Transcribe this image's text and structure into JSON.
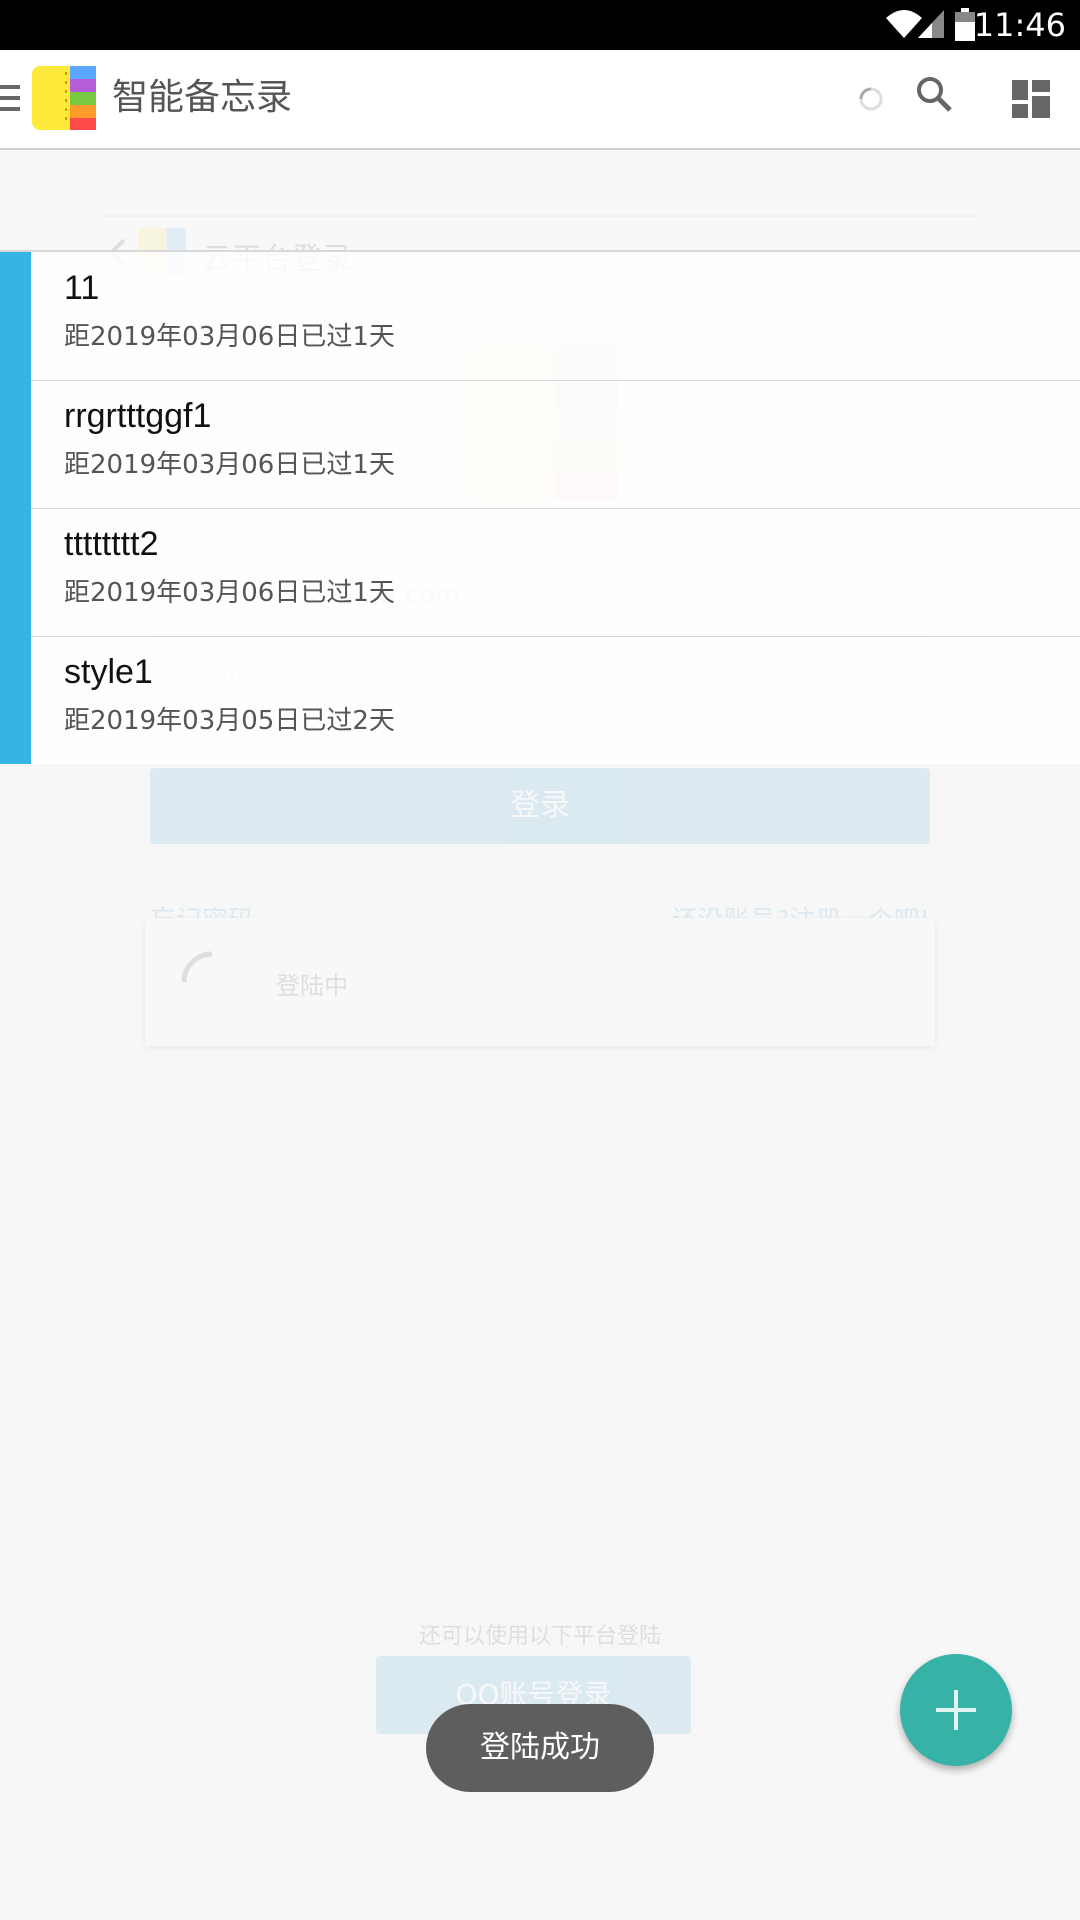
{
  "status_bar": {
    "time": "11:46",
    "icons": [
      "wifi-icon",
      "cell-signal-icon",
      "battery-icon"
    ]
  },
  "app_bar": {
    "title": "智能备忘录",
    "icons": [
      "menu-icon",
      "app-logo",
      "loading-spinner-icon",
      "search-icon",
      "dashboard-icon"
    ]
  },
  "notes": [
    {
      "name": "11",
      "subtitle": "距2019年03月06日已过1天"
    },
    {
      "name": "rrgrtttggf1",
      "subtitle": "距2019年03月06日已过1天"
    },
    {
      "name": "tttttttt2",
      "subtitle": "距2019年03月06日已过1天"
    },
    {
      "name": "style1",
      "subtitle": "距2019年03月05日已过2天"
    }
  ],
  "background_login": {
    "header_title": "云平台登录",
    "account_hint": "q.com",
    "password_mask": "·········",
    "login_button": "登录",
    "forgot_password": "忘记密码",
    "register_prompt": "还没账号?注册一个吧!",
    "loading_text": "登陆中",
    "other_platforms_note": "还可以使用以下平台登陆",
    "qq_login_button": "QQ账号登录"
  },
  "toast": {
    "message": "登陆成功"
  },
  "fab": {
    "icon": "plus-icon"
  },
  "colors": {
    "accent_bar": "#35b5e5",
    "fab": "#36b3a6",
    "toast_bg": "#5e5e5e",
    "status_bar": "#000000"
  }
}
